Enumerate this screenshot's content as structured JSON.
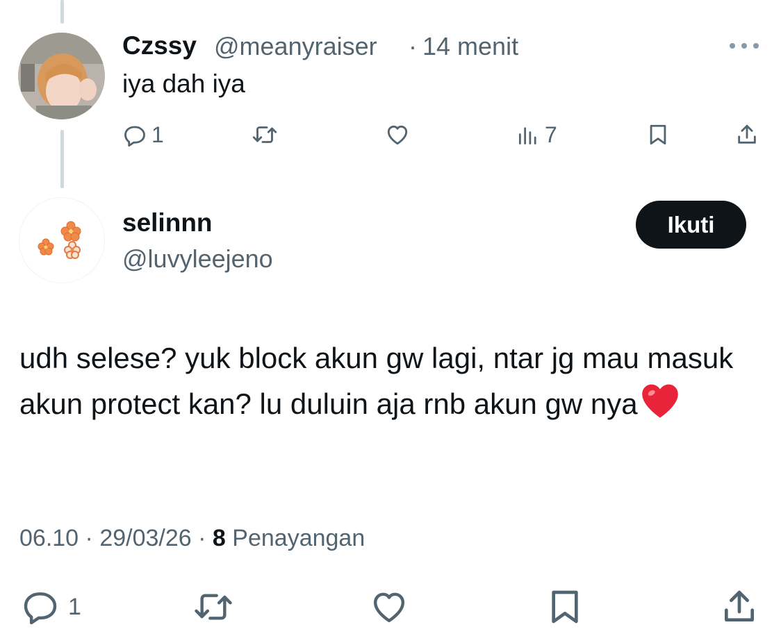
{
  "reply": {
    "display_name": "Czssy",
    "handle": "@meanyraiser",
    "separator": "·",
    "time": "14 menit",
    "more_label": "···",
    "text": "iya dah iya",
    "actions": {
      "reply_count": "1",
      "retweet_count": "",
      "like_count": "",
      "views_count": "7"
    }
  },
  "tweet": {
    "display_name": "selinnn",
    "handle": "@luvyleejeno",
    "follow_label": "Ikuti",
    "text": "udh selese? yuk block akun gw lagi, ntar jg mau masuk akun protect kan? lu duluin aja rnb akun gw nya",
    "emoji": "❤️",
    "meta": {
      "time": "06.10",
      "sep1": "·",
      "date": "29/03/26",
      "sep2": "·",
      "views_count": "8",
      "views_label": "Penayangan"
    },
    "actions": {
      "reply_count": "1"
    }
  },
  "colors": {
    "text": "#0f1419",
    "muted": "#536471",
    "thread_line": "#cfd9de",
    "follow_bg": "#0f1419",
    "heart": "#e0245e"
  },
  "icons": [
    "reply-icon",
    "retweet-icon",
    "like-icon",
    "views-icon",
    "bookmark-icon",
    "share-icon",
    "more-icon"
  ]
}
